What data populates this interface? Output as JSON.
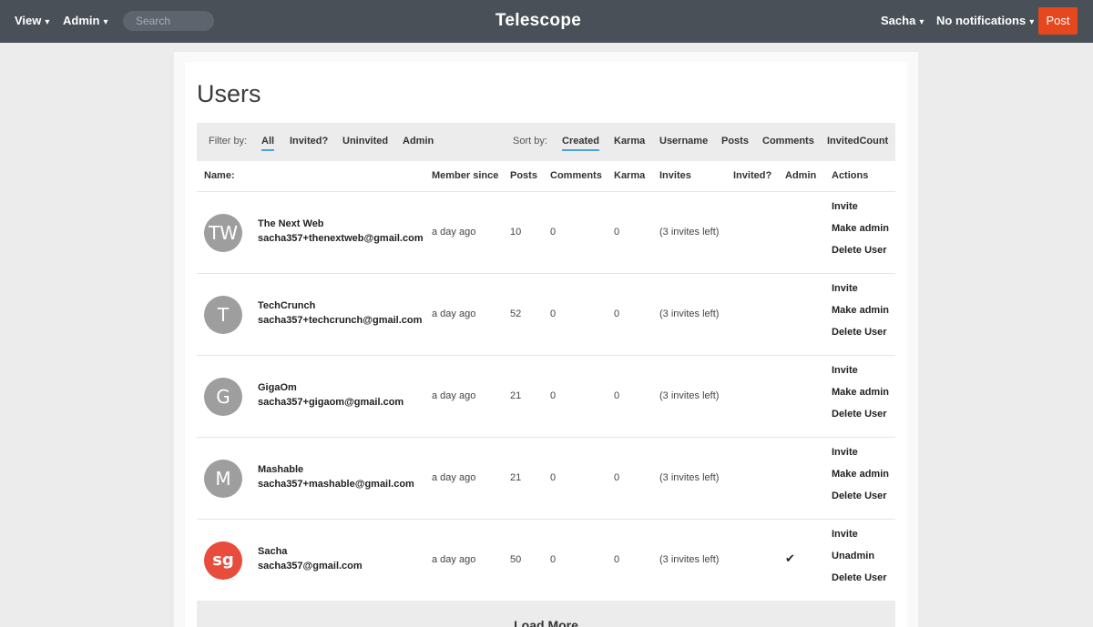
{
  "nav": {
    "view_label": "View",
    "admin_label": "Admin",
    "search_placeholder": "Search",
    "brand": "Telescope",
    "user_label": "Sacha",
    "notifications_label": "No notifications",
    "post_label": "Post",
    "caret": "▾"
  },
  "page": {
    "title": "Users"
  },
  "filters": {
    "filter_label": "Filter by:",
    "filter_options": [
      "All",
      "Invited?",
      "Uninvited",
      "Admin"
    ],
    "active_filter": "All",
    "sort_label": "Sort by:",
    "sort_options": [
      "Created",
      "Karma",
      "Username",
      "Posts",
      "Comments",
      "InvitedCount"
    ],
    "active_sort": "Created"
  },
  "table": {
    "columns": [
      "Name:",
      "Member since",
      "Posts",
      "Comments",
      "Karma",
      "Invites",
      "Invited?",
      "Admin",
      "Actions"
    ],
    "rows": [
      {
        "avatar": "TW",
        "name": "The Next Web",
        "email": "sacha357+thenextweb@gmail.com",
        "member_since": "a day ago",
        "posts": "10",
        "comments": "0",
        "karma": "0",
        "invites": "(3 invites left)",
        "admin": "",
        "actions": [
          "Invite",
          "Make admin",
          "Delete User"
        ]
      },
      {
        "avatar": "T",
        "name": "TechCrunch",
        "email": "sacha357+techcrunch@gmail.com",
        "member_since": "a day ago",
        "posts": "52",
        "comments": "0",
        "karma": "0",
        "invites": "(3 invites left)",
        "admin": "",
        "actions": [
          "Invite",
          "Make admin",
          "Delete User"
        ]
      },
      {
        "avatar": "G",
        "name": "GigaOm",
        "email": "sacha357+gigaom@gmail.com",
        "member_since": "a day ago",
        "posts": "21",
        "comments": "0",
        "karma": "0",
        "invites": "(3 invites left)",
        "admin": "",
        "actions": [
          "Invite",
          "Make admin",
          "Delete User"
        ]
      },
      {
        "avatar": "M",
        "name": "Mashable",
        "email": "sacha357+mashable@gmail.com",
        "member_since": "a day ago",
        "posts": "21",
        "comments": "0",
        "karma": "0",
        "invites": "(3 invites left)",
        "admin": "",
        "actions": [
          "Invite",
          "Make admin",
          "Delete User"
        ]
      },
      {
        "avatar": "sg",
        "name": "Sacha",
        "email": "sacha357@gmail.com",
        "member_since": "a day ago",
        "posts": "50",
        "comments": "0",
        "karma": "0",
        "invites": "(3 invites left)",
        "admin": "✔",
        "actions": [
          "Invite",
          "Unadmin",
          "Delete User"
        ]
      }
    ]
  },
  "load_more_label": "Load More",
  "colors": {
    "nav_bg": "#4a5058",
    "post_button": "#e5471f",
    "active_underline": "#4aa3df",
    "avatar_grey": "#9e9e9e",
    "avatar_red": "#e74c3c"
  }
}
